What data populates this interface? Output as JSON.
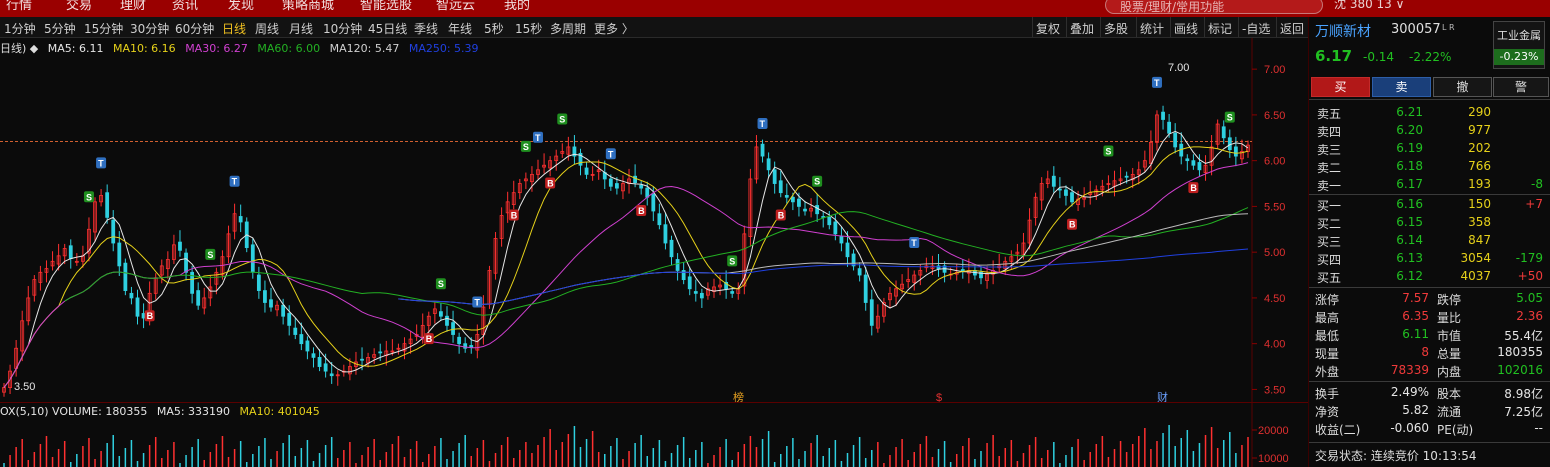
{
  "top_menu": [
    "行情",
    "交易",
    "理财",
    "资讯",
    "发现",
    "策略商城",
    "智能选股",
    "智远云",
    "我的"
  ],
  "search": {
    "placeholder": "股票/理财/常用功能"
  },
  "top_right": "沈   380   13   ∨",
  "period_tabs": [
    {
      "label": "1分钟",
      "active": false
    },
    {
      "label": "5分钟",
      "active": false
    },
    {
      "label": "15分钟",
      "active": false
    },
    {
      "label": "30分钟",
      "active": false
    },
    {
      "label": "60分钟",
      "active": false
    },
    {
      "label": "日线",
      "active": true
    },
    {
      "label": "周线",
      "active": false
    },
    {
      "label": "月线",
      "active": false
    },
    {
      "label": "10分钟",
      "active": false
    },
    {
      "label": "45日线",
      "active": false
    },
    {
      "label": "季线",
      "active": false
    },
    {
      "label": "年线",
      "active": false
    },
    {
      "label": "5秒",
      "active": false
    },
    {
      "label": "15秒",
      "active": false
    },
    {
      "label": "多周期",
      "active": false
    },
    {
      "label": "更多 〉",
      "active": false
    }
  ],
  "tools": [
    "复权",
    "叠加",
    "多股",
    "统计",
    "画线",
    "标记",
    "-自选",
    "返回"
  ],
  "ma_legend": {
    "prefix": "日线) ◆",
    "items": [
      {
        "label": "MA5: 6.11",
        "color": "#e6e6e6"
      },
      {
        "label": "MA10: 6.16",
        "color": "#e6d11a"
      },
      {
        "label": "MA30: 6.27",
        "color": "#d040d0"
      },
      {
        "label": "MA60: 6.00",
        "color": "#23b023"
      },
      {
        "label": "MA120: 5.47",
        "color": "#d0d0d0"
      },
      {
        "label": "MA250: 5.39",
        "color": "#2040e0"
      }
    ]
  },
  "volume_legend": {
    "items": [
      {
        "label": "OX(5,10)  VOLUME: 180355",
        "color": "#e6e6e6"
      },
      {
        "label": "MA5: 333190",
        "color": "#e6e6e6"
      },
      {
        "label": "MA10: 401045",
        "color": "#e6d11a"
      }
    ]
  },
  "chart_data": {
    "type": "candlestick",
    "y_axis_ticks": [
      "7.00",
      "6.50",
      "6.00",
      "5.50",
      "5.00",
      "4.50",
      "4.00",
      "3.50"
    ],
    "ylim": [
      3.45,
      7.1
    ],
    "volume_ticks": [
      "20000",
      "10000"
    ],
    "high_label": "7.00",
    "low_label": "3.50",
    "reference_price": 6.21,
    "event_markers": [
      "榜",
      "$",
      "财"
    ],
    "signals_sample": [
      "S",
      "T",
      "B"
    ],
    "closes": [
      3.52,
      3.7,
      3.95,
      4.25,
      4.5,
      4.7,
      4.78,
      4.82,
      4.9,
      4.96,
      5.04,
      4.93,
      4.9,
      4.96,
      5.25,
      5.55,
      5.62,
      5.38,
      5.1,
      4.85,
      4.58,
      4.5,
      4.3,
      4.28,
      4.55,
      4.72,
      4.85,
      4.92,
      5.08,
      5.02,
      4.78,
      4.55,
      4.42,
      4.5,
      4.62,
      4.78,
      4.95,
      5.2,
      5.42,
      5.33,
      5.05,
      4.78,
      4.58,
      4.45,
      4.4,
      4.42,
      4.3,
      4.2,
      4.1,
      4.0,
      3.92,
      3.85,
      3.75,
      3.7,
      3.65,
      3.66,
      3.7,
      3.75,
      3.8,
      3.82,
      3.85,
      3.88,
      3.9,
      3.92,
      3.92,
      3.95,
      4.0,
      4.05,
      4.1,
      4.2,
      4.3,
      4.38,
      4.3,
      4.2,
      4.1,
      4.0,
      3.95,
      3.96,
      4.1,
      4.4,
      4.8,
      5.15,
      5.4,
      5.55,
      5.65,
      5.75,
      5.8,
      5.85,
      5.9,
      5.95,
      6.0,
      6.05,
      6.1,
      6.15,
      6.05,
      5.95,
      5.85,
      5.85,
      5.9,
      5.8,
      5.72,
      5.7,
      5.75,
      5.8,
      5.76,
      5.7,
      5.6,
      5.45,
      5.3,
      5.1,
      4.95,
      4.8,
      4.7,
      4.6,
      4.55,
      4.5,
      4.6,
      4.62,
      4.64,
      4.6,
      4.55,
      4.6,
      5.2,
      5.8,
      6.15,
      6.05,
      5.9,
      5.75,
      5.65,
      5.6,
      5.55,
      5.5,
      5.45,
      5.48,
      5.42,
      5.38,
      5.3,
      5.2,
      5.1,
      4.95,
      4.85,
      4.75,
      4.45,
      4.2,
      4.3,
      4.45,
      4.55,
      4.6,
      4.65,
      4.7,
      4.75,
      4.8,
      4.85,
      4.85,
      4.82,
      4.78,
      4.76,
      4.78,
      4.8,
      4.8,
      4.75,
      4.72,
      4.76,
      4.8,
      4.85,
      4.9,
      4.95,
      5.0,
      5.1,
      5.35,
      5.6,
      5.75,
      5.8,
      5.72,
      5.68,
      5.62,
      5.55,
      5.58,
      5.6,
      5.65,
      5.68,
      5.72,
      5.75,
      5.78,
      5.8,
      5.82,
      5.85,
      5.9,
      6.0,
      6.2,
      6.5,
      6.45,
      6.3,
      6.15,
      6.05,
      6.0,
      5.95,
      5.9,
      5.95,
      6.15,
      6.4,
      6.25,
      6.12,
      6.05,
      6.1,
      6.17
    ]
  },
  "quote": {
    "name": "万顺新材",
    "code": "300057",
    "lr": "L R",
    "price": "6.17",
    "change": "-0.14",
    "pct": "-2.22%",
    "sector": "工业金属",
    "sector_pct": "-0.23%"
  },
  "trade_buttons": [
    "买",
    "卖",
    "撤",
    "警"
  ],
  "asks": [
    {
      "label": "卖五",
      "price": "6.21",
      "vol": "290",
      "delta": ""
    },
    {
      "label": "卖四",
      "price": "6.20",
      "vol": "977",
      "delta": ""
    },
    {
      "label": "卖三",
      "price": "6.19",
      "vol": "202",
      "delta": ""
    },
    {
      "label": "卖二",
      "price": "6.18",
      "vol": "766",
      "delta": ""
    },
    {
      "label": "卖一",
      "price": "6.17",
      "vol": "193",
      "delta": "-8"
    }
  ],
  "bids": [
    {
      "label": "买一",
      "price": "6.16",
      "vol": "150",
      "delta": "+7"
    },
    {
      "label": "买二",
      "price": "6.15",
      "vol": "358",
      "delta": ""
    },
    {
      "label": "买三",
      "price": "6.14",
      "vol": "847",
      "delta": ""
    },
    {
      "label": "买四",
      "price": "6.13",
      "vol": "3054",
      "delta": "-179"
    },
    {
      "label": "买五",
      "price": "6.12",
      "vol": "4037",
      "delta": "+50"
    }
  ],
  "stats1": [
    {
      "l1": "涨停",
      "v1": "7.57",
      "l2": "跌停",
      "v2": "5.05"
    },
    {
      "l1": "最高",
      "v1": "6.35",
      "l2": "量比",
      "v2": "2.36"
    },
    {
      "l1": "最低",
      "v1": "6.11",
      "l2": "市值",
      "v2": "55.4亿"
    },
    {
      "l1": "现量",
      "v1": "8",
      "l2": "总量",
      "v2": "180355"
    },
    {
      "l1": "外盘",
      "v1": "78339",
      "l2": "内盘",
      "v2": "102016"
    }
  ],
  "stats2": [
    {
      "l1": "换手",
      "v1": "2.49%",
      "l2": "股本",
      "v2": "8.98亿"
    },
    {
      "l1": "净资",
      "v1": "5.82",
      "l2": "流通",
      "v2": "7.25亿"
    },
    {
      "l1": "收益(二)",
      "v1": "-0.060",
      "l2": "PE(动)",
      "v2": "--"
    }
  ],
  "status": "交易状态: 连续竞价  10:13:54"
}
